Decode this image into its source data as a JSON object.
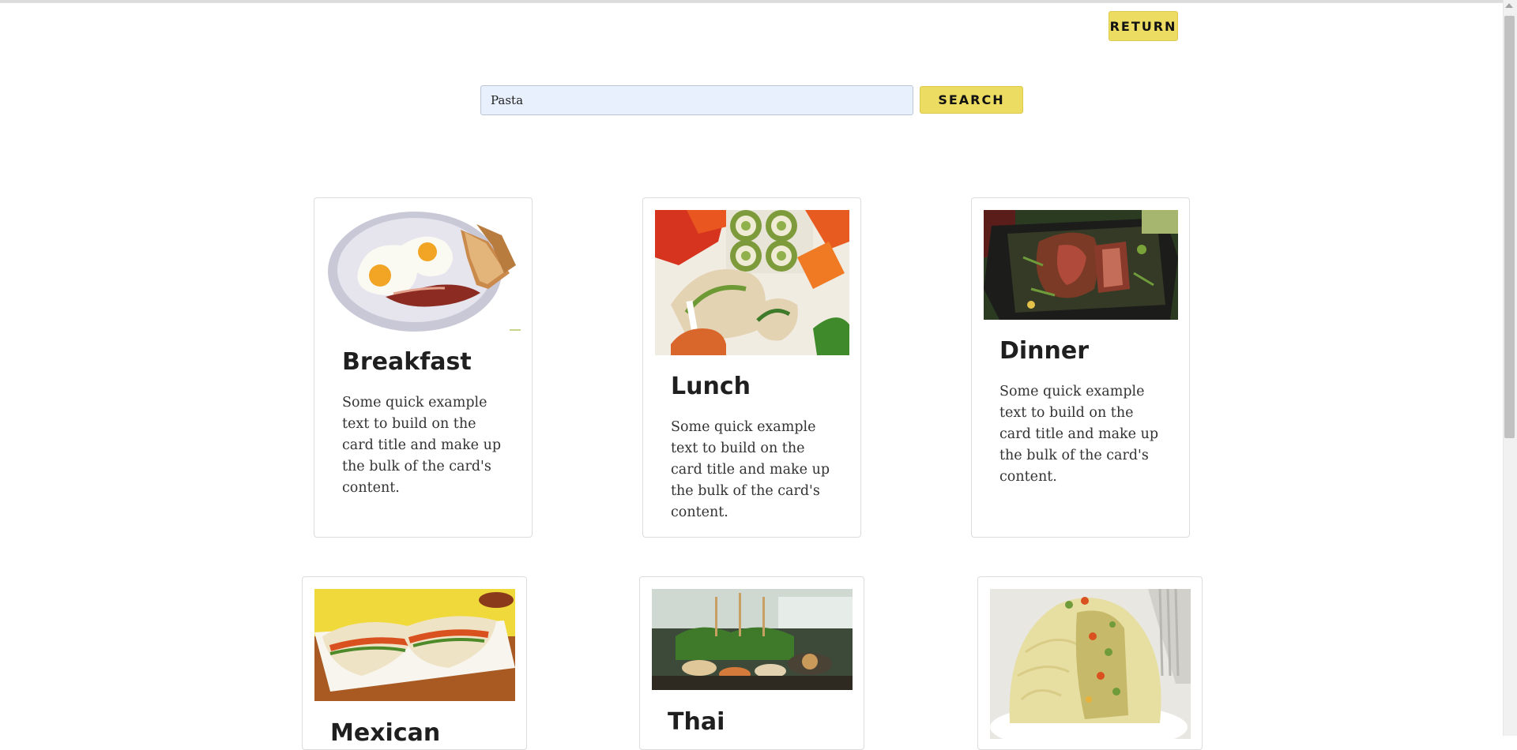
{
  "header": {
    "return_label": "RETURN"
  },
  "search": {
    "value": "Pasta",
    "button_label": "SEARCH"
  },
  "cards": [
    {
      "title": "Breakfast",
      "text": "Some quick example text to build on the card title and make up the bulk of the card's content."
    },
    {
      "title": "Lunch",
      "text": "Some quick example text to build on the card title and make up the bulk of the card's content."
    },
    {
      "title": "Dinner",
      "text": "Some quick example text to build on the card title and make up the bulk of the card's content."
    },
    {
      "title": "Mexican",
      "text": ""
    },
    {
      "title": "Thai",
      "text": ""
    },
    {
      "title": "",
      "text": ""
    }
  ],
  "colors": {
    "accent": "#ecdc62",
    "input_bg": "#e8f0fe"
  }
}
